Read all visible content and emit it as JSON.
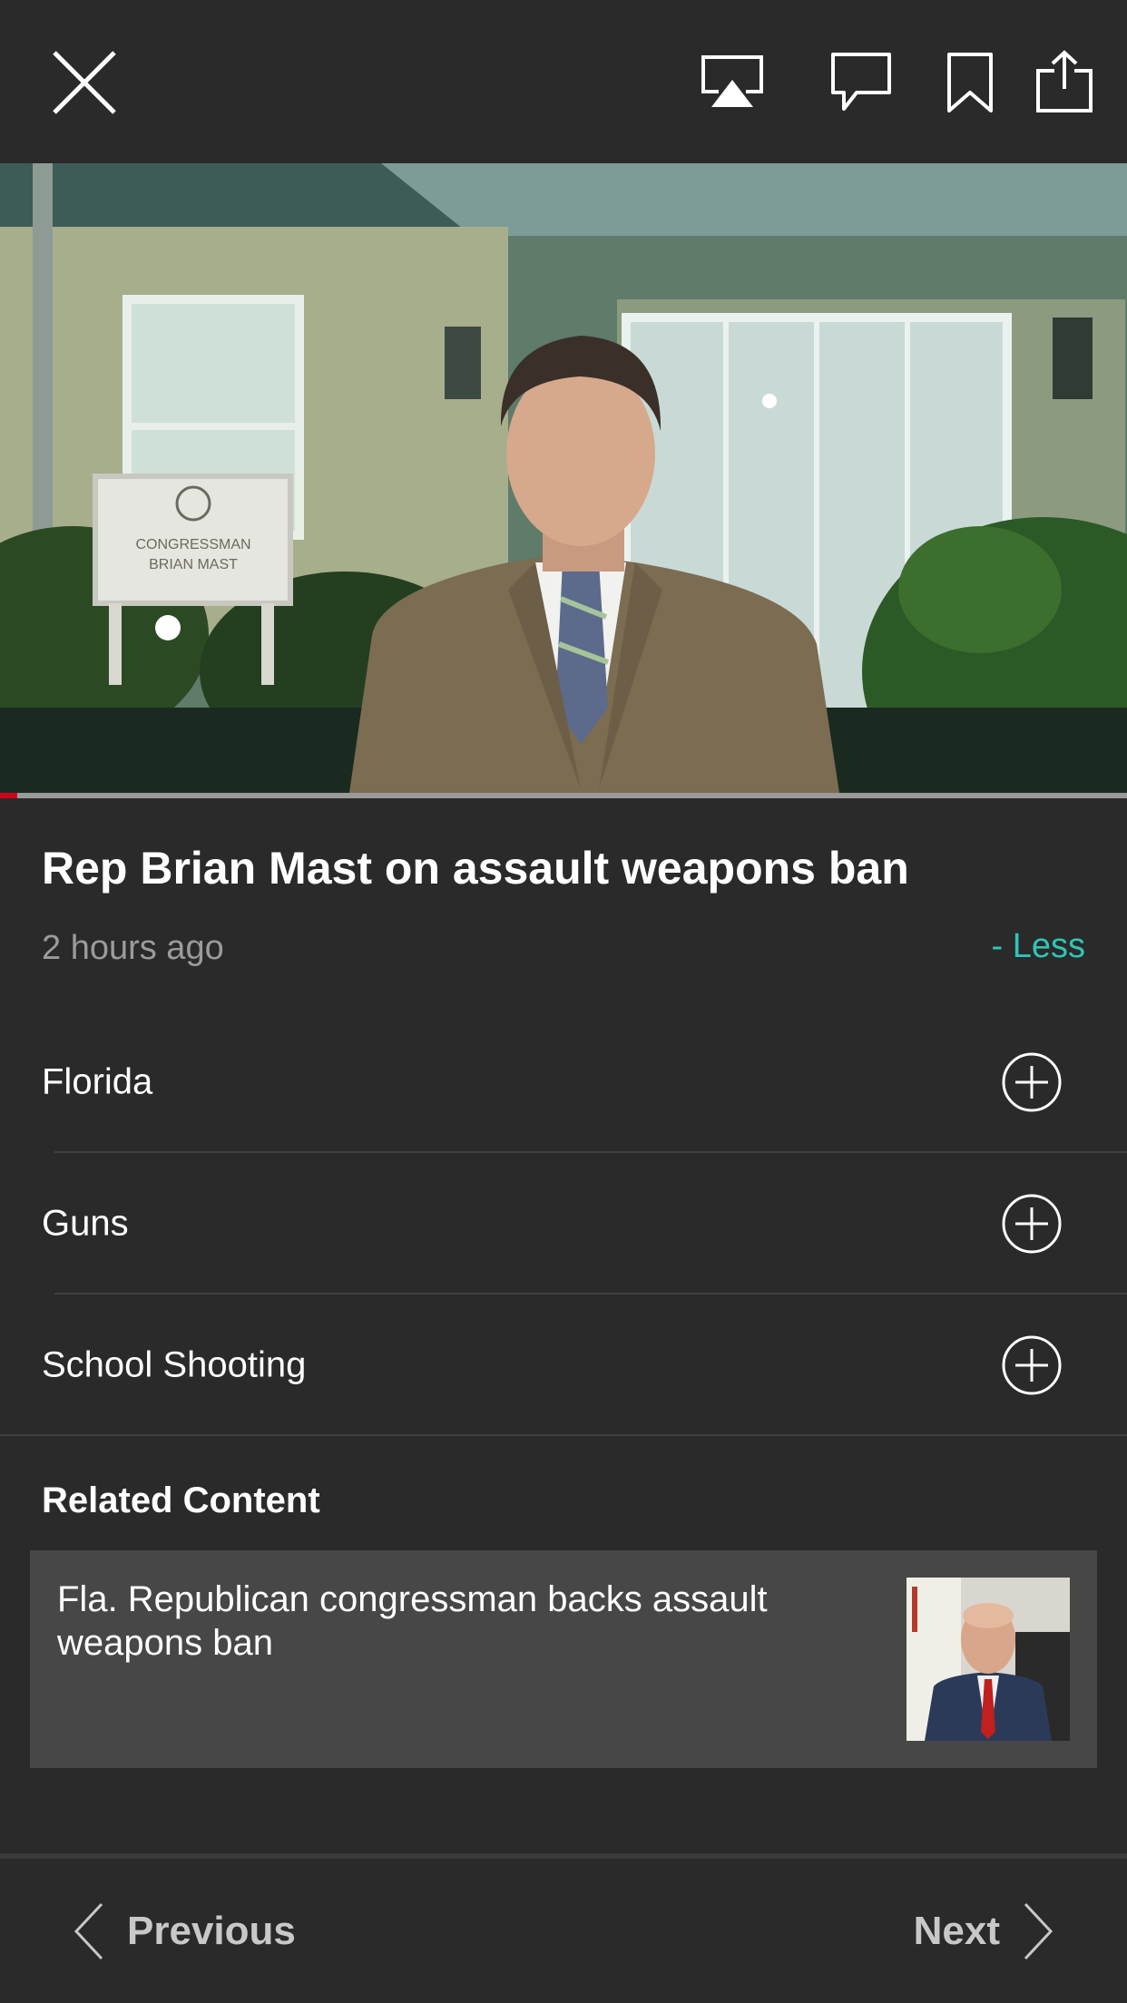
{
  "video": {
    "progress_fraction": 0.015,
    "sign_text": [
      "CONGRESSMAN",
      "BRIAN MAST"
    ]
  },
  "article": {
    "title": "Rep Brian Mast on assault weapons ban",
    "time_ago": "2 hours ago",
    "toggle_label": "- Less"
  },
  "topics": [
    {
      "label": "Florida"
    },
    {
      "label": "Guns"
    },
    {
      "label": "School Shooting"
    }
  ],
  "related": {
    "heading": "Related Content",
    "items": [
      {
        "title": "Fla. Republican congressman backs assault weapons ban"
      }
    ]
  },
  "navigation": {
    "previous_label": "Previous",
    "next_label": "Next"
  },
  "icons": [
    "close-icon",
    "airplay-icon",
    "comment-icon",
    "bookmark-icon",
    "share-icon",
    "plus-circle-icon",
    "chevron-left-icon",
    "chevron-right-icon"
  ],
  "colors": {
    "background": "#2a2a2a",
    "accent": "#2fc6b6",
    "progress": "#d0021b",
    "card": "#474747"
  }
}
